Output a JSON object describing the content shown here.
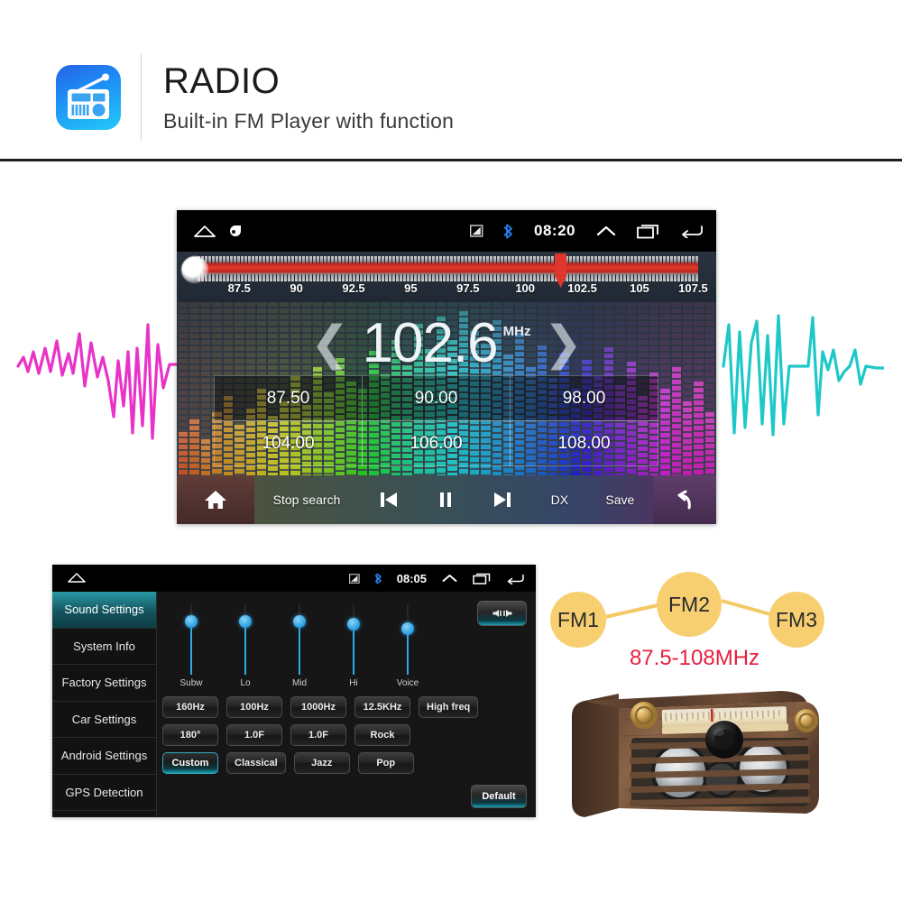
{
  "header": {
    "icon_name": "radio-app-icon",
    "title": "RADIO",
    "subtitle": "Built-in FM  Player with function"
  },
  "radio_screen": {
    "status_bar": {
      "home_icon": "home-icon",
      "app_icon": "notification-app-icon",
      "signal_icon": "signal-icon",
      "bluetooth_icon": "bluetooth-icon",
      "time": "08:20",
      "expand_icon": "chevron-up-icon",
      "recents_icon": "recents-icon",
      "back_icon": "back-icon"
    },
    "tuner": {
      "labels": [
        "87.5",
        "90",
        "92.5",
        "95",
        "97.5",
        "100",
        "102.5",
        "105",
        "107.5"
      ],
      "positions": [
        8.5,
        19.9,
        31.3,
        42.7,
        54.1,
        65.5,
        76.9,
        88.3,
        99.0
      ],
      "needle_percent": 72.5,
      "range_min": "87.5",
      "range_max": "108"
    },
    "display": {
      "prev_icon": "chevron-left-icon",
      "frequency": "102.6",
      "unit": "MHz",
      "next_icon": "chevron-right-icon"
    },
    "presets": [
      {
        "label": "87.50",
        "selected": true
      },
      {
        "label": "90.00",
        "selected": true
      },
      {
        "label": "98.00",
        "selected": true
      },
      {
        "label": "104.00",
        "selected": false
      },
      {
        "label": "106.00",
        "selected": false
      },
      {
        "label": "108.00",
        "selected": false
      }
    ],
    "controls": {
      "home_icon": "home-icon",
      "stop_search": "Stop search",
      "prev_icon": "previous-track-icon",
      "pause_icon": "pause-icon",
      "next_icon": "next-track-icon",
      "dx": "DX",
      "save": "Save",
      "back_icon": "back-arrow-icon"
    }
  },
  "settings_screen": {
    "status_bar": {
      "home_icon": "home-icon",
      "signal_icon": "signal-icon",
      "bluetooth_icon": "bluetooth-icon",
      "time": "08:05",
      "expand_icon": "chevron-up-icon",
      "recents_icon": "recents-icon",
      "back_icon": "back-icon"
    },
    "sidebar": [
      {
        "label": "Sound Settings",
        "active": true
      },
      {
        "label": "System Info",
        "active": false
      },
      {
        "label": "Factory Settings",
        "active": false
      },
      {
        "label": "Car Settings",
        "active": false
      },
      {
        "label": "Android Settings",
        "active": false
      },
      {
        "label": "GPS Detection",
        "active": false
      }
    ],
    "sliders": [
      {
        "label": "Subw",
        "value": 76
      },
      {
        "label": "Lo",
        "value": 76
      },
      {
        "label": "Mid",
        "value": 76
      },
      {
        "label": "Hi",
        "value": 72
      },
      {
        "label": "Voice",
        "value": 66
      }
    ],
    "balance_button": "balance-fader-icon",
    "button_rows": [
      [
        {
          "label": "160Hz",
          "on": false
        },
        {
          "label": "100Hz",
          "on": false
        },
        {
          "label": "1000Hz",
          "on": false
        },
        {
          "label": "12.5KHz",
          "on": false
        },
        {
          "label": "High freq",
          "on": false
        }
      ],
      [
        {
          "label": "180°",
          "on": false
        },
        {
          "label": "1.0F",
          "on": false
        },
        {
          "label": "1.0F",
          "on": false
        },
        {
          "label": "Rock",
          "on": false
        }
      ],
      [
        {
          "label": "Custom",
          "on": true
        },
        {
          "label": "Classical",
          "on": false
        },
        {
          "label": "Jazz",
          "on": false
        },
        {
          "label": "Pop",
          "on": false
        }
      ]
    ],
    "default_button": "Default"
  },
  "fm_diagram": {
    "nodes": [
      "FM1",
      "FM2",
      "FM3"
    ],
    "range_text": "87.5-108MHz",
    "node_color": "#f7cf71",
    "range_color": "#e3213f"
  },
  "retro_radio": {
    "name": "retro-wooden-radio-image"
  },
  "decorations": {
    "left_wave": "pink-waveform",
    "right_wave": "cyan-waveform",
    "left_wave_color": "#e832c8",
    "right_wave_color": "#1fc8c8"
  }
}
